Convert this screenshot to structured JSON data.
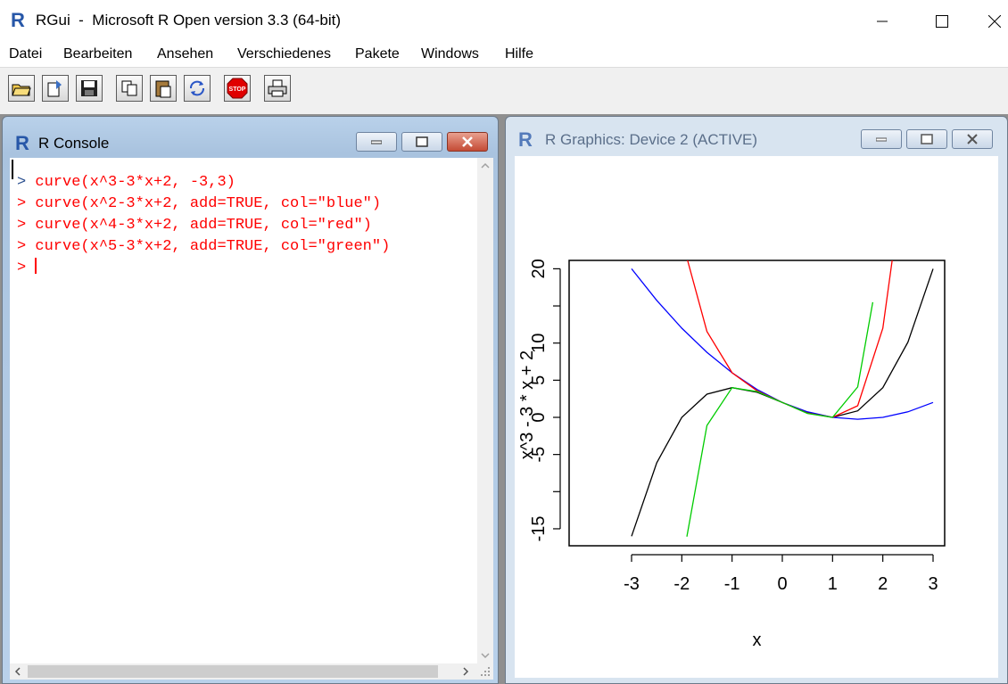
{
  "app": {
    "title": "RGui  -  Microsoft R Open version 3.3 (64-bit)"
  },
  "menu": [
    "Datei",
    "Bearbeiten",
    "Ansehen",
    "Verschiedenes",
    "Pakete",
    "Windows",
    "Hilfe"
  ],
  "toolbar": {
    "buttons": [
      "open-script-icon",
      "load-workspace-icon",
      "save-icon",
      "copy-icon",
      "paste-icon",
      "copy-paste-icon",
      "stop-icon",
      "print-icon"
    ],
    "stop_label": "STOP"
  },
  "console": {
    "title": "R Console",
    "prompt": ">",
    "lines": [
      "curve(x^3-3*x+2, -3,3)",
      "curve(x^2-3*x+2, add=TRUE, col=\"blue\")",
      "curve(x^4-3*x+2, add=TRUE, col=\"red\")",
      "curve(x^5-3*x+2, add=TRUE, col=\"green\")"
    ],
    "text_color": "#ff0000",
    "prompt_color": "#2a4f8f"
  },
  "graphics": {
    "title": "R Graphics: Device 2 (ACTIVE)"
  },
  "chart_data": {
    "type": "line",
    "xlabel": "x",
    "ylabel": "x^3 - 3 * x + 2",
    "xlim": [
      -3,
      3
    ],
    "ylim": [
      -16,
      20
    ],
    "xticks": [
      -3,
      -2,
      -1,
      0,
      1,
      2,
      3
    ],
    "yticks": [
      -15,
      -10,
      -5,
      0,
      5,
      10,
      15,
      20
    ],
    "ytick_labels": [
      "-15",
      "",
      "-5",
      "0",
      "5",
      "10",
      "",
      "20"
    ],
    "series": [
      {
        "color": "#000000",
        "x": [
          -3,
          -2.5,
          -2,
          -1.5,
          -1,
          -0.5,
          0,
          0.5,
          1,
          1.5,
          2,
          2.5,
          3
        ],
        "y": [
          -16,
          -6.125,
          0,
          3.125,
          4,
          3.375,
          2,
          0.625,
          0,
          0.875,
          4,
          10.125,
          20
        ]
      },
      {
        "color": "#0000ff",
        "x": [
          -3,
          -2.5,
          -2,
          -1.5,
          -1,
          -0.5,
          0,
          0.5,
          1,
          1.5,
          2,
          2.5,
          3
        ],
        "y": [
          20,
          15.75,
          12,
          8.75,
          6,
          3.75,
          2,
          0.75,
          0,
          -0.25,
          0,
          0.75,
          2
        ]
      },
      {
        "color": "#ff0000",
        "x": [
          -2,
          -1.5,
          -1,
          -0.5,
          0,
          0.5,
          1,
          1.5,
          2,
          2.5
        ],
        "y": [
          24,
          11.56,
          6,
          3.56,
          2,
          0.56,
          0,
          1.56,
          12,
          36.56
        ]
      },
      {
        "color": "#00cc00",
        "x": [
          -1.9,
          -1.5,
          -1,
          -0.5,
          0,
          0.5,
          1,
          1.5,
          1.8
        ],
        "y": [
          -16.06,
          -1.09,
          4,
          3.47,
          2,
          0.53,
          0,
          4.09,
          15.5
        ]
      }
    ]
  }
}
